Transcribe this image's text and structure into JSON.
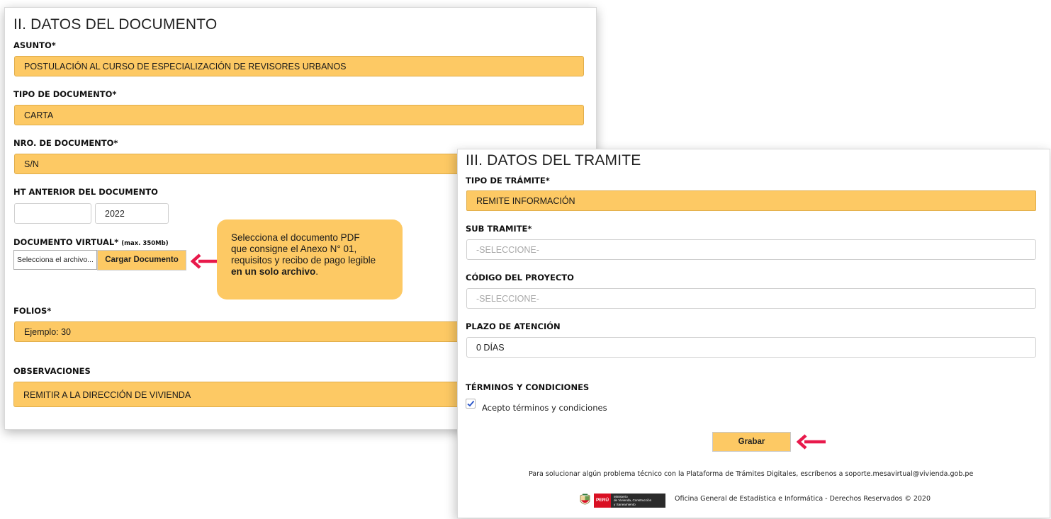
{
  "documento": {
    "title": "II. DATOS DEL DOCUMENTO",
    "asunto_label": "ASUNTO*",
    "asunto_value": "POSTULACIÓN AL CURSO DE ESPECIALIZACIÓN DE REVISORES URBANOS",
    "tipo_label": "TIPO DE DOCUMENTO*",
    "tipo_value": "CARTA",
    "nro_label": "NRO. DE DOCUMENTO*",
    "nro_value": "S/N",
    "ht_label": "HT ANTERIOR DEL DOCUMENTO",
    "ht_number": "",
    "ht_year": "2022",
    "virtual_label": "DOCUMENTO VIRTUAL*",
    "virtual_max": "(max. 350Mb)",
    "file_placeholder": "Selecciona el archivo...",
    "upload_button": "Cargar Documento",
    "folios_label": "FOLIOS*",
    "folios_placeholder": "Ejemplo: 30",
    "obs_label": "OBSERVACIONES",
    "obs_value": "REMITIR A LA DIRECCIÓN DE VIVIENDA"
  },
  "tooltip": {
    "line1": "Selecciona el documento PDF",
    "line2": "que consigne el Anexo N° 01,",
    "line3": "requisitos y recibo de pago legible",
    "line4_bold": "en un solo archivo",
    "line4_end": "."
  },
  "tramite": {
    "title": "III. DATOS DEL TRAMITE",
    "tipo_label": "TIPO DE TRÁMITE*",
    "tipo_value": "REMITE INFORMACIÓN",
    "sub_label": "SUB TRAMITE*",
    "sub_value": "-SELECCIONE-",
    "codigo_label": "CÓDIGO DEL PROYECTO",
    "codigo_value": "-SELECCIONE-",
    "plazo_label": "PLAZO DE ATENCIÓN",
    "plazo_value": "0 DÍAS",
    "terminos_label": "TÉRMINOS Y CONDICIONES",
    "accept_label": "Acepto términos y condiciones",
    "accept_checked": true,
    "save_button": "Grabar",
    "support_text": "Para solucionar algún problema técnico con la Plataforma de Trámites Digitales, escríbenos a soporte.mesavirtual@vivienda.gob.pe",
    "logo_peru": "PERÚ",
    "logo_ministry_1": "Ministerio",
    "logo_ministry_2": "de Vivienda, Construcción",
    "logo_ministry_3": "y Saneamiento",
    "copyright": "Oficina General de Estadística e Informática - Derechos Reservados © 2020"
  },
  "colors": {
    "field_fill": "#fdc964",
    "arrow": "#e8194b",
    "peru_red": "#d91023"
  }
}
